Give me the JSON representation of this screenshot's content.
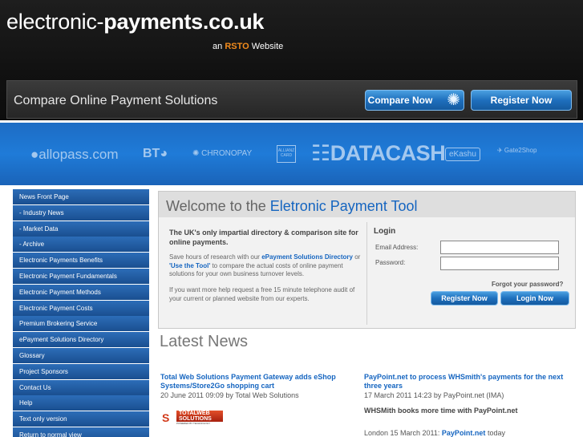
{
  "header": {
    "logo_light": "electronic-",
    "logo_bold": "payments.co.uk",
    "tagline_prefix": "an",
    "tagline_brand": "RSTO",
    "tagline_suffix": "Website"
  },
  "compare_bar": {
    "title": "Compare Online Payment Solutions",
    "compare_button": "Compare Now",
    "register_button": "Register Now",
    "compare_icon": "gear-icon"
  },
  "sponsors": {
    "allopass": "●allopass.com",
    "bt": "BT◕",
    "chronopay": "✺ CHRONOPAY",
    "small": "ALLIANZ CARD",
    "datacash": "☷DATACASH",
    "ekashu": "eKashu",
    "gate2shop": "✈ Gate2Shop"
  },
  "sidebar": {
    "items": [
      {
        "label": "News Front Page"
      },
      {
        "label": "- Industry News"
      },
      {
        "label": "- Market Data"
      },
      {
        "label": "- Archive"
      },
      {
        "label": "Electronic Payments Benefits"
      },
      {
        "label": "Electronic Payment Fundamentals"
      },
      {
        "label": "Electronic Payment Methods"
      },
      {
        "label": "Electronic Payment Costs"
      },
      {
        "label": "Premium Brokering Service"
      },
      {
        "label": "ePayment Solutions Directory"
      },
      {
        "label": "Glossary"
      },
      {
        "label": "Project Sponsors"
      },
      {
        "label": "Contact Us"
      },
      {
        "label": "Help"
      },
      {
        "label": "Text only version"
      },
      {
        "label": "Return to normal view"
      }
    ]
  },
  "welcome": {
    "title_prefix": "Welcome to the",
    "title_highlight": "Eletronic Payment Tool",
    "intro_strong": "The UK's only impartial directory & comparison site for online payments.",
    "intro_part1": "Save hours of research with our",
    "intro_link1": "ePayment Solutions Directory",
    "intro_part2": "or",
    "intro_link2": "'Use the Tool'",
    "intro_part3": "to compare the actual costs of online payment solutions for your own business turnover levels.",
    "help_text": "If you want more help request a free 15 minute telephone audit of your current or planned website from our experts."
  },
  "login": {
    "title": "Login",
    "email_label": "Email Address:",
    "email_value": "",
    "password_label": "Password:",
    "password_value": "",
    "forgot": "Forgot your password?",
    "register_button": "Register Now",
    "login_button": "Login Now"
  },
  "latest": {
    "title": "Latest News",
    "news": [
      {
        "headline": "Total Web Solutions Payment Gateway adds eShop Systems/Store2Go shopping cart",
        "meta": "20 June 2011 09:09 by Total Web Solutions",
        "logo_text": "TOTALWEB SOLUTIONS",
        "logo_tagline": "POWERED BY TECHNOLOGY"
      },
      {
        "headline": "PayPoint.net to process WHSmith's payments for the next three years",
        "meta": "17 March 2011 14:23 by PayPoint.net (IMA)",
        "subheadline": "WHSMith books more time with PayPoint.net",
        "body_prefix": "London 15 March 2011:",
        "body_link": "PayPoint.net",
        "body_suffix": "today"
      }
    ]
  },
  "colors": {
    "header_bg": "#111111",
    "accent_blue": "#1565c0",
    "brand_orange": "#f28b1c",
    "sponsor_blue": "#1f7bd8",
    "nav_blue": "#1a4f90"
  }
}
